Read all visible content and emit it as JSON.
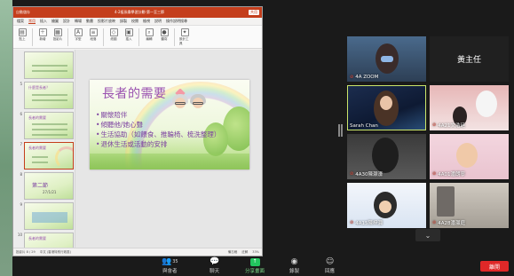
{
  "ppt": {
    "autosave": "自動儲存",
    "doc_title": "4-2祖孫樂學習計劃-第一至三節",
    "share_label": "共用",
    "menu": [
      "檔案",
      "常用",
      "插入",
      "繪圖",
      "設計",
      "轉場",
      "動畫",
      "投影片放映",
      "錄製",
      "校閱",
      "檢視",
      "說明",
      "操作說明搜尋"
    ],
    "ribbon": [
      "貼上",
      "新增",
      "投影片",
      "字型",
      "段落",
      "繪圖",
      "插入",
      "編輯",
      "聽寫",
      "設計工具"
    ],
    "thumb_numbers": [
      "",
      "5",
      "6",
      "7",
      "8",
      "9",
      "10"
    ],
    "thumb_titles": [
      "",
      "什麼是長者？",
      "長者的需要",
      "長者的需要",
      "",
      "",
      "長者的需要"
    ],
    "section_title": "第二節",
    "section_date": "27/1/21",
    "slide_title": "長者的需要",
    "slide_bullets": [
      "關懷陪伴",
      "傾聽他/她心聲",
      "生活協助（如餵食、推輪椅、梳洗整理）",
      "退休生活或活動的安排"
    ],
    "status_left": "投影片 8 / 29",
    "status_lang": "中文 (香港特別行政區)",
    "status_notes": "備忘稿",
    "status_comments": "註解",
    "zoom": "33%"
  },
  "gallery": {
    "tiles": [
      {
        "name": "4A ZOOM",
        "muted": true
      },
      {
        "name": "黃主任",
        "muted": false
      },
      {
        "name": "Sarah Chan",
        "muted": false
      },
      {
        "name": "4A21文浩廷",
        "muted": true
      },
      {
        "name": "4A30陳灏濠",
        "muted": true
      },
      {
        "name": "4A01潘朗寧",
        "muted": true
      },
      {
        "name": "4A15陳梓灝",
        "muted": true
      },
      {
        "name": "4A28潘灝庭",
        "muted": true
      }
    ]
  },
  "toolbar": {
    "participants_label": "與會者",
    "participants_count": "35",
    "chat_label": "聊天",
    "share_label": "分享畫面",
    "record_label": "錄製",
    "reactions_label": "回應",
    "leave_label": "離開"
  },
  "colors": {
    "ppt_accent": "#c43e1c",
    "slide_text": "#9a52b0",
    "active_speaker": "#cbe56a",
    "leave": "#e02828",
    "share": "#22c55e"
  }
}
